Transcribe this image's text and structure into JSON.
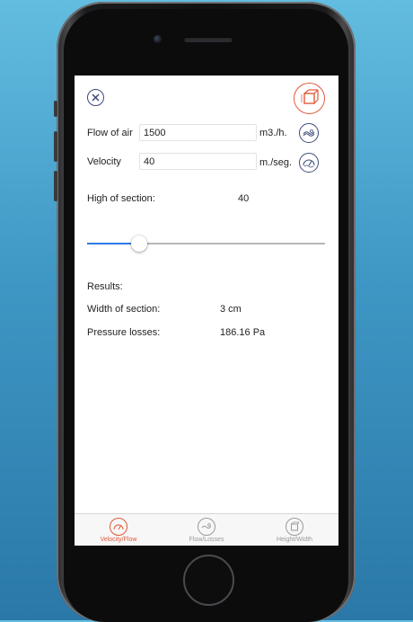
{
  "form": {
    "flow_label": "Flow of air",
    "flow_value": "1500",
    "flow_unit": "m3./h.",
    "velocity_label": "Velocity",
    "velocity_value": "40",
    "velocity_unit": "m./seg.",
    "high_label": "High of section:",
    "high_value": "40",
    "slider_fraction": 0.22
  },
  "results": {
    "title": "Results:",
    "width_label": "Width of section:",
    "width_value": "3 cm",
    "pressure_label": "Pressure losses:",
    "pressure_value": "186.16 Pa"
  },
  "tabs": [
    {
      "label": "Velocity/Flow",
      "icon": "velocity-flow-icon",
      "active": true
    },
    {
      "label": "Flow/Losses",
      "icon": "flow-losses-icon",
      "active": false
    },
    {
      "label": "Height/Width",
      "icon": "height-width-icon",
      "active": false
    }
  ],
  "colors": {
    "accent": "#e05a3a",
    "icon": "#3c4a7a",
    "slider": "#2f7ae5",
    "inactive_tab": "#9a9a9a",
    "background_top": "#63bde0",
    "background_bottom": "#2a78a8"
  }
}
